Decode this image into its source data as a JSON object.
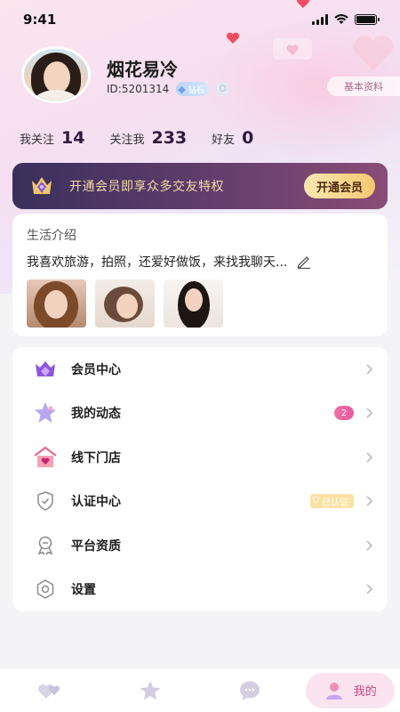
{
  "status_bar": {
    "time": "9:41"
  },
  "profile": {
    "name": "烟花易冷",
    "id_text": "ID:5201314",
    "level_badge": "钻石",
    "basic_info_button": "基本资料"
  },
  "stats": [
    {
      "label": "我关注",
      "value": "14"
    },
    {
      "label": "关注我",
      "value": "233"
    },
    {
      "label": "好友",
      "value": "0"
    }
  ],
  "vip_banner": {
    "text": "开通会员即享众多交友特权",
    "button": "开通会员"
  },
  "intro": {
    "title": "生活介绍",
    "text": "我喜欢旅游，拍照，还爱好做饭，来找我聊天..."
  },
  "menu": [
    {
      "label": "会员中心",
      "icon": "crown-diamond-icon"
    },
    {
      "label": "我的动态",
      "icon": "star-icon",
      "badge": "2"
    },
    {
      "label": "线下门店",
      "icon": "store-heart-icon"
    },
    {
      "label": "认证中心",
      "icon": "shield-check-icon",
      "badge": "已认证"
    },
    {
      "label": "平台资质",
      "icon": "certificate-icon"
    },
    {
      "label": "设置",
      "icon": "gear-icon"
    }
  ],
  "tab_bar": {
    "tabs": [
      {
        "icon": "hearts-icon"
      },
      {
        "icon": "star-tab-icon"
      },
      {
        "icon": "chat-bubble-icon"
      },
      {
        "icon": "profile-tab-icon",
        "label": "我的"
      }
    ]
  },
  "colors": {
    "accent": "#c4457f",
    "vip_gold": "#f6dca6",
    "banner_dark": "#3a2f5c"
  }
}
